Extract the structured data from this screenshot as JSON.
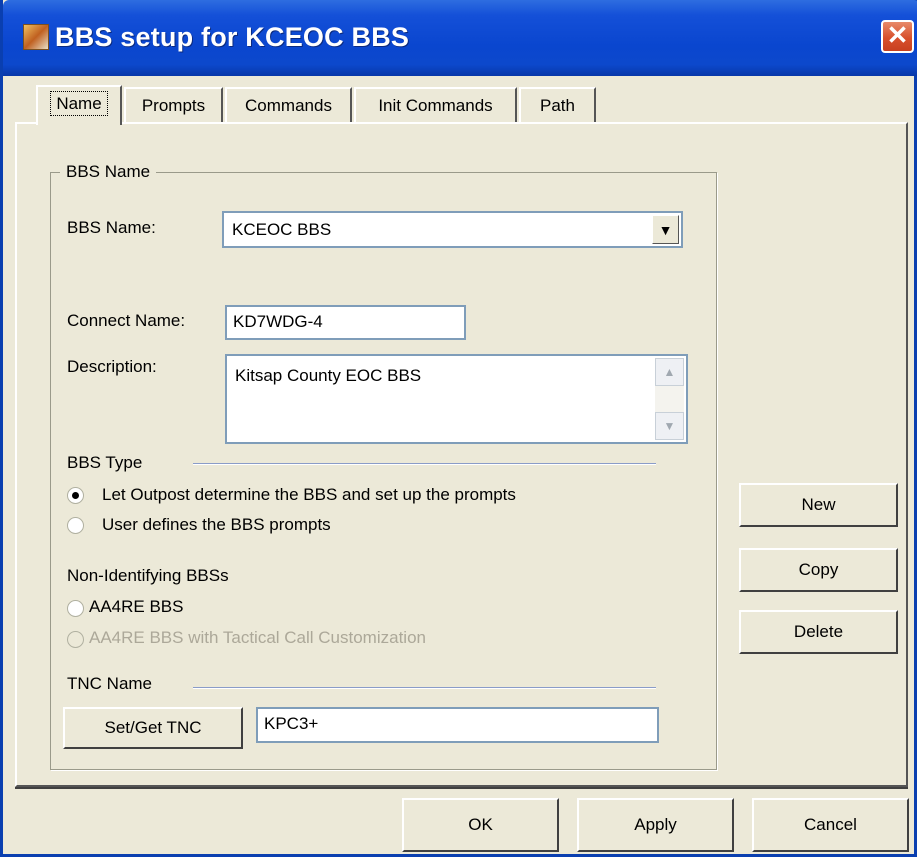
{
  "window": {
    "title": "BBS setup for KCEOC BBS",
    "close_glyph": "✕"
  },
  "tabs": [
    {
      "label": "Name",
      "active": true
    },
    {
      "label": "Prompts"
    },
    {
      "label": "Commands"
    },
    {
      "label": "Init Commands"
    },
    {
      "label": "Path"
    }
  ],
  "bbs_name_group": {
    "legend": "BBS Name",
    "bbs_name_label": "BBS Name:",
    "bbs_name_value": "KCEOC BBS",
    "connect_name_label": "Connect Name:",
    "connect_name_value": "KD7WDG-4",
    "description_label": "Description:",
    "description_value": "Kitsap County EOC BBS"
  },
  "bbs_type": {
    "heading": "BBS Type",
    "options": [
      {
        "label": "Let Outpost determine the BBS and set up the prompts",
        "checked": true
      },
      {
        "label": "User defines the BBS prompts",
        "checked": false
      }
    ]
  },
  "non_identifying": {
    "heading": "Non-Identifying BBSs",
    "options": [
      {
        "label": "AA4RE BBS",
        "checked": false,
        "enabled": true
      },
      {
        "label": "AA4RE BBS with Tactical Call Customization",
        "checked": false,
        "enabled": false
      }
    ]
  },
  "tnc": {
    "heading": "TNC Name",
    "button_label": "Set/Get TNC",
    "value": "KPC3+"
  },
  "side_buttons": {
    "new": "New",
    "copy": "Copy",
    "delete": "Delete"
  },
  "footer_buttons": {
    "ok": "OK",
    "apply": "Apply",
    "cancel": "Cancel"
  },
  "icons": {
    "combo_arrow": "▼",
    "scroll_up": "▲",
    "scroll_down": "▼"
  },
  "colors": {
    "titlebar": "#0a46cf",
    "face": "#ece9d8",
    "close": "#d8502c"
  }
}
